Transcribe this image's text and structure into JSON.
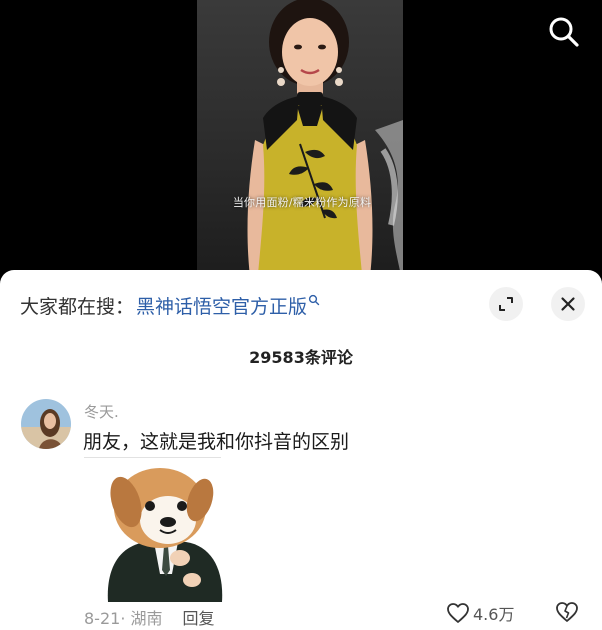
{
  "video": {
    "caption": "当你用面粉/糯米粉作为原料",
    "search_icon": "search-icon"
  },
  "sheet": {
    "trending_prefix": "大家都在搜：",
    "trending_link": "黑神话悟空官方正版",
    "trending_icon": "search-icon",
    "expand_icon": "expand-icon",
    "close_icon": "close-icon",
    "comment_count": "29583条评论"
  },
  "comment": {
    "username": "冬天.",
    "text": "朋友，这就是我和你抖音的区别",
    "sticker": "puppy-in-suit-sticker",
    "date_location": "8-21· 湖南",
    "reply_label": "回复",
    "likes": "4.6万",
    "like_icon": "heart-icon",
    "dislike_icon": "broken-heart-icon"
  },
  "colors": {
    "link": "#2e5fa8",
    "muted": "#9a9a9a",
    "dress": "#c8b22a"
  }
}
